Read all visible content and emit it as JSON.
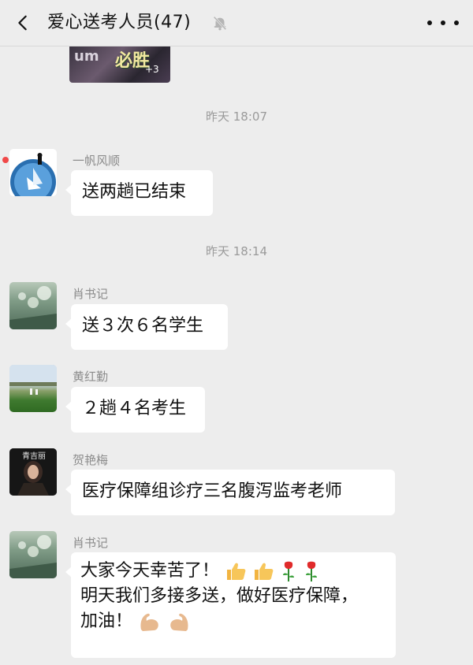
{
  "header": {
    "title": "爱心送考人员(47)"
  },
  "messages": {
    "ts1": "昨天 18:07",
    "m1": {
      "sender": "一帆风顺",
      "text": "送两趟已结束"
    },
    "ts2": "昨天 18:14",
    "m2": {
      "sender": "肖书记",
      "text": "送３次６名学生"
    },
    "m3": {
      "sender": "黄红勤",
      "text": "２趟４名考生"
    },
    "m4": {
      "sender": "贺艳梅",
      "text": "医疗保障组诊疗三名腹泻监考老师",
      "avatar_caption": "青吉丽"
    },
    "m5": {
      "sender": "肖书记",
      "line1": "大家今天幸苦了！",
      "line2": "明天我们多接多送，做好医疗保障，",
      "line3": "加油！"
    }
  },
  "icons": {
    "back": "chevron-left-icon",
    "mute": "bell-off-icon",
    "more": "more-dots-icon",
    "thumbs_up": "thumbs-up-emoji",
    "rose": "rose-emoji",
    "muscle": "flexed-biceps-emoji"
  },
  "colors": {
    "background": "#ededed",
    "bubble": "#ffffff",
    "unread_dot": "#f04848"
  }
}
